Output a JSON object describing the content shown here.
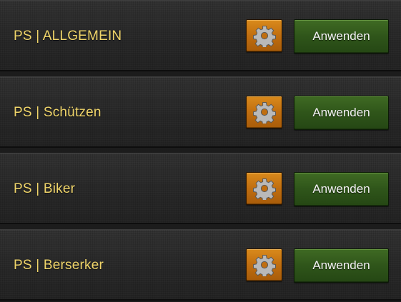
{
  "colors": {
    "label": "#f0d56a",
    "settings_button": "#c06e10",
    "apply_button": "#2f551a"
  },
  "presets": [
    {
      "label": "PS | ALLGEMEIN",
      "settings_icon": "gear-icon",
      "apply_label": "Anwenden"
    },
    {
      "label": "PS | Schützen",
      "settings_icon": "gear-icon",
      "apply_label": "Anwenden"
    },
    {
      "label": "PS | Biker",
      "settings_icon": "gear-icon",
      "apply_label": "Anwenden"
    },
    {
      "label": "PS | Berserker",
      "settings_icon": "gear-icon",
      "apply_label": "Anwenden"
    }
  ]
}
